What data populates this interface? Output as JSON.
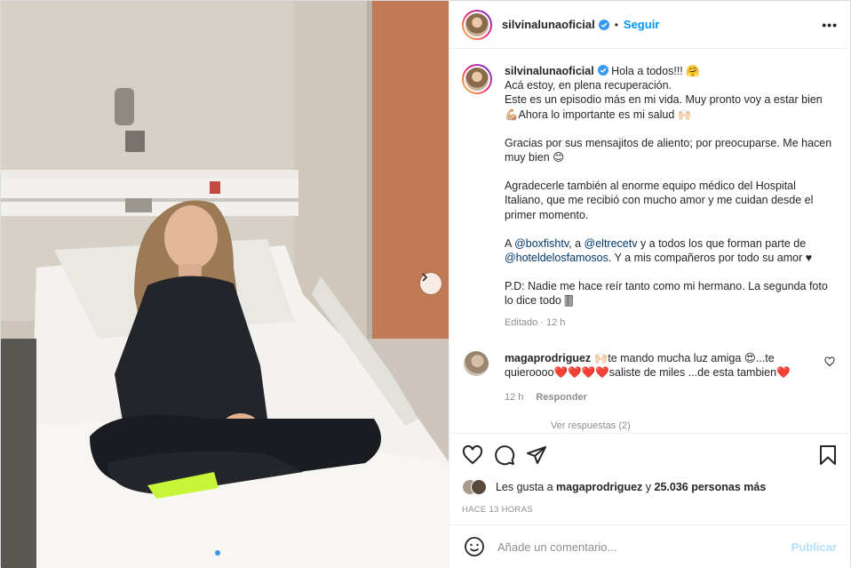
{
  "header": {
    "username": "silvinalunaoficial",
    "bullet": "•",
    "follow_label": "Seguir",
    "more_label": "•••"
  },
  "caption": {
    "username": "silvinalunaoficial",
    "line1_text": "Hola a todos!!! 🤗",
    "line2": "Acá estoy, en plena recuperación.",
    "line3": "Este es un episodio más en mi vida. Muy pronto voy a estar bien 💪🏼Ahora lo importante es mi salud 🙌🏻",
    "para2": "Gracias por sus mensajitos de aliento; por preocuparse. Me hacen muy bien 😊",
    "para3": "Agradecerle también al enorme equipo médico del Hospital Italiano, que me recibió con mucho amor y me cuidan desde el primer momento.",
    "para4_a": "A ",
    "mention1": "@boxfishtv",
    "para4_b": ", a ",
    "mention2": "@eltrecetv",
    "para4_c": " y a todos los que forman parte de ",
    "mention3": "@hoteldelosfamosos",
    "para4_d": ". Y a mis compañeros por todo su amor ♥",
    "para5": "P.D: Nadie me hace reír tanto como mi hermano. La segunda foto lo dice todo 🀫",
    "edited": "Editado · 12 h"
  },
  "comment": {
    "username": "magaprodriguez",
    "text": " 🙌🏻te mando mucha luz amiga 😍...te quieroooo❤️❤️❤️❤️saliste de miles ...de esta tambien❤️",
    "time": "12 h",
    "reply_label": "Responder",
    "view_replies": "Ver respuestas (2)"
  },
  "likes": {
    "prefix": "Les gusta a ",
    "user": "magaprodriguez",
    "middle": " y ",
    "count": "25.036 personas más"
  },
  "timestamp": "HACE 13 HORAS",
  "add_comment": {
    "placeholder": "Añade un comentario...",
    "publish_label": "Publicar"
  },
  "carousel": {
    "current": 1,
    "total": 2
  },
  "colors": {
    "accent": "#0095f6",
    "publish_disabled": "#b2dffc",
    "muted": "#8e8e8e",
    "mention": "#00376b"
  }
}
